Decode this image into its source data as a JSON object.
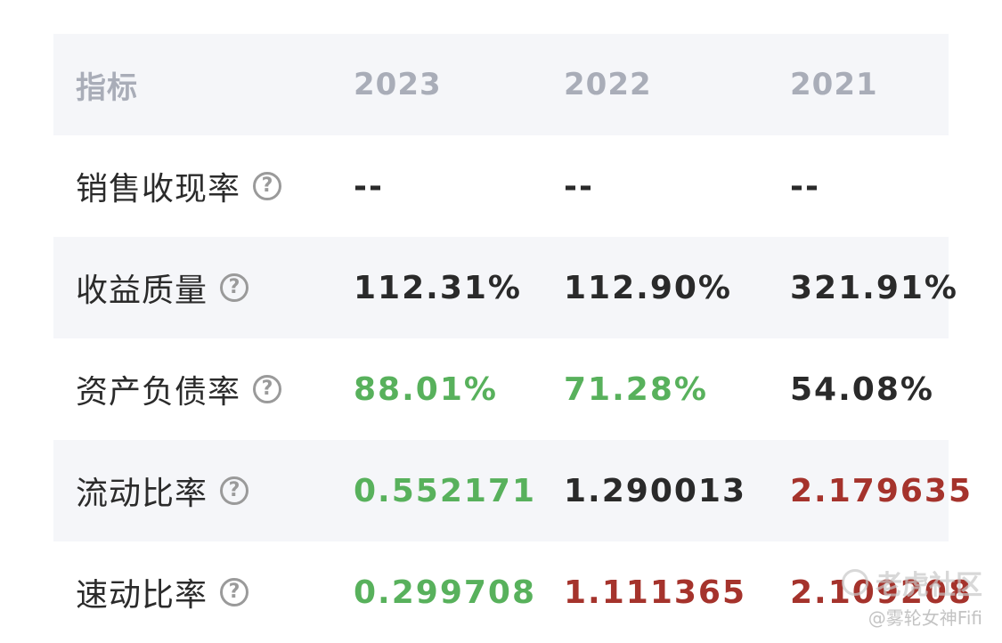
{
  "table": {
    "header": {
      "metric": "指标",
      "years": [
        "2023",
        "2022",
        "2021"
      ]
    },
    "rows": [
      {
        "label": "销售收现率",
        "help_icon": "question-circle-icon",
        "values": [
          {
            "text": "--",
            "color": "neutral"
          },
          {
            "text": "--",
            "color": "neutral"
          },
          {
            "text": "--",
            "color": "neutral"
          }
        ]
      },
      {
        "label": "收益质量",
        "help_icon": "question-circle-icon",
        "values": [
          {
            "text": "112.31%",
            "color": "neutral"
          },
          {
            "text": "112.90%",
            "color": "neutral"
          },
          {
            "text": "321.91%",
            "color": "neutral"
          }
        ]
      },
      {
        "label": "资产负债率",
        "help_icon": "question-circle-icon",
        "values": [
          {
            "text": "88.01%",
            "color": "green"
          },
          {
            "text": "71.28%",
            "color": "green"
          },
          {
            "text": "54.08%",
            "color": "neutral"
          }
        ]
      },
      {
        "label": "流动比率",
        "help_icon": "question-circle-icon",
        "values": [
          {
            "text": "0.552171",
            "color": "green"
          },
          {
            "text": "1.290013",
            "color": "neutral"
          },
          {
            "text": "2.179635",
            "color": "red"
          }
        ]
      },
      {
        "label": "速动比率",
        "help_icon": "question-circle-icon",
        "values": [
          {
            "text": "0.299708",
            "color": "green"
          },
          {
            "text": "1.111365",
            "color": "red"
          },
          {
            "text": "2.109208",
            "color": "red"
          }
        ]
      }
    ]
  },
  "colors": {
    "neutral": "#2a2a2a",
    "green": "#58b15c",
    "red": "#a5332c",
    "header_text": "#a9adb8",
    "shaded_row": "#f5f6f9"
  },
  "watermark": {
    "brand": "老虎社区",
    "user": "@雾轮女神Fifi"
  }
}
